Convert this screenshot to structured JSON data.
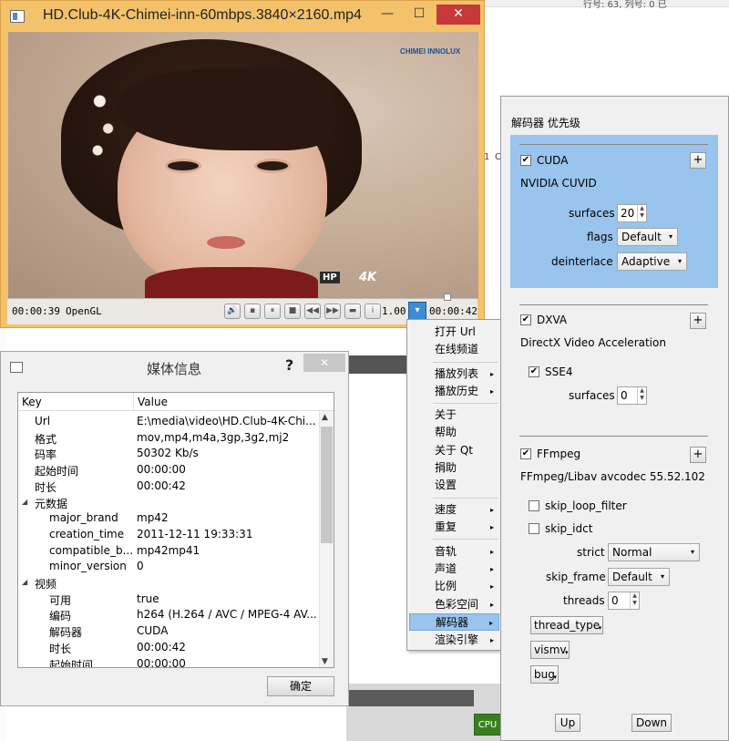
{
  "desktop": {
    "top_strip_text": "行号: 63,  列号: 0  已",
    "side_text_1": "a",
    "side_text_2": "c",
    "side_text_3": "1",
    "side_text_4": "C",
    "cpu_label": "CPU"
  },
  "player": {
    "title": "HD.Club-4K-Chimei-inn-60mbps.3840×2160.mp4",
    "minimize": "—",
    "maximize": "☐",
    "close": "✕",
    "video_logo_top": "CHIMEI INNOLUX",
    "video_logo_bottom": "HP",
    "video_logo_4k": "4K",
    "elapsed": "00:00:39",
    "renderer": "OpenGL",
    "speed": "1.00",
    "total": "00:00:42",
    "controls": [
      {
        "name": "volume-icon",
        "glyph": "🔊"
      },
      {
        "name": "screenshot-icon",
        "glyph": "▪"
      },
      {
        "name": "pause-icon",
        "glyph": "⏸"
      },
      {
        "name": "stop-icon",
        "glyph": "■"
      },
      {
        "name": "rewind-icon",
        "glyph": "◀◀"
      },
      {
        "name": "forward-icon",
        "glyph": "▶▶"
      },
      {
        "name": "open-file-icon",
        "glyph": "▬"
      },
      {
        "name": "info-icon",
        "glyph": "i"
      }
    ],
    "menu_toggle_glyph": "▾"
  },
  "context_menu": {
    "items": [
      {
        "label": "打开 Url",
        "submenu": false
      },
      {
        "label": "在线频道",
        "submenu": false
      },
      {
        "label": "播放列表",
        "submenu": true
      },
      {
        "label": "播放历史",
        "submenu": true
      },
      {
        "label": "关于",
        "submenu": false
      },
      {
        "label": "帮助",
        "submenu": false
      },
      {
        "label": "关于 Qt",
        "submenu": false
      },
      {
        "label": "捐助",
        "submenu": false
      },
      {
        "label": "设置",
        "submenu": false
      },
      {
        "label": "速度",
        "submenu": true
      },
      {
        "label": "重复",
        "submenu": true
      },
      {
        "label": "音轨",
        "submenu": true
      },
      {
        "label": "声道",
        "submenu": true
      },
      {
        "label": "比例",
        "submenu": true
      },
      {
        "label": "色彩空间",
        "submenu": true
      },
      {
        "label": "解码器",
        "submenu": true,
        "active": true
      },
      {
        "label": "渲染引擎",
        "submenu": true
      }
    ],
    "arrow_glyph": "▸"
  },
  "media_info": {
    "title": "媒体信息",
    "help": "?",
    "close": "✕",
    "col_key": "Key",
    "col_value": "Value",
    "rows": [
      {
        "key": "Url",
        "value": "E:\\media\\video\\HD.Club-4K-Chi...",
        "level": 1
      },
      {
        "key": "格式",
        "value": "mov,mp4,m4a,3gp,3g2,mj2",
        "level": 1
      },
      {
        "key": "码率",
        "value": "50302 Kb/s",
        "level": 1
      },
      {
        "key": "起始时间",
        "value": "00:00:00",
        "level": 1
      },
      {
        "key": "时长",
        "value": "00:00:42",
        "level": 1
      },
      {
        "key": "元数据",
        "value": "",
        "level": 0
      },
      {
        "key": "major_brand",
        "value": "mp42",
        "level": 2
      },
      {
        "key": "creation_time",
        "value": "2011-12-11 19:33:31",
        "level": 2
      },
      {
        "key": "compatible_b...",
        "value": "mp42mp41",
        "level": 2
      },
      {
        "key": "minor_version",
        "value": "0",
        "level": 2
      },
      {
        "key": "视频",
        "value": "",
        "level": 0
      },
      {
        "key": "可用",
        "value": "true",
        "level": 2
      },
      {
        "key": "编码",
        "value": "h264 (H.264 / AVC / MPEG-4 AV...",
        "level": 2
      },
      {
        "key": "解码器",
        "value": "CUDA",
        "level": 2
      },
      {
        "key": "时长",
        "value": "00:00:42",
        "level": 2
      },
      {
        "key": "起始时间",
        "value": "00:00:00",
        "level": 2
      }
    ],
    "expand_glyph": "◢",
    "scroll_up": "▲",
    "scroll_down": "▼",
    "ok_label": "确定"
  },
  "decoder_panel": {
    "title": "解码器 优先级",
    "cuda": {
      "checkbox": "✔",
      "name": "CUDA",
      "plus": "+",
      "description": "NVIDIA CUVID",
      "surfaces_label": "surfaces",
      "surfaces_value": "20",
      "flags_label": "flags",
      "flags_value": "Default",
      "deinterlace_label": "deinterlace",
      "deinterlace_value": "Adaptive",
      "highlight_color": "#99c4ed"
    },
    "dxva": {
      "checkbox": "✔",
      "name": "DXVA",
      "plus": "+",
      "description": "DirectX Video Acceleration",
      "sse4_checkbox": "✔",
      "sse4_label": "SSE4",
      "surfaces_label": "surfaces",
      "surfaces_value": "0"
    },
    "ffmpeg": {
      "checkbox": "✔",
      "name": "FFmpeg",
      "plus": "+",
      "description": "FFmpeg/Libav avcodec 55.52.102",
      "skip_loop_filter_label": "skip_loop_filter",
      "skip_idct_label": "skip_idct",
      "strict_label": "strict",
      "strict_value": "Normal",
      "skip_frame_label": "skip_frame",
      "skip_frame_value": "Default",
      "threads_label": "threads",
      "threads_value": "0",
      "thread_type_label": "thread_type",
      "vismv_label": "vismv",
      "bug_label": "bug"
    },
    "spin_glyph": "▲\n▼",
    "dropdown_glyph": "▾",
    "up_label": "Up",
    "down_label": "Down"
  }
}
